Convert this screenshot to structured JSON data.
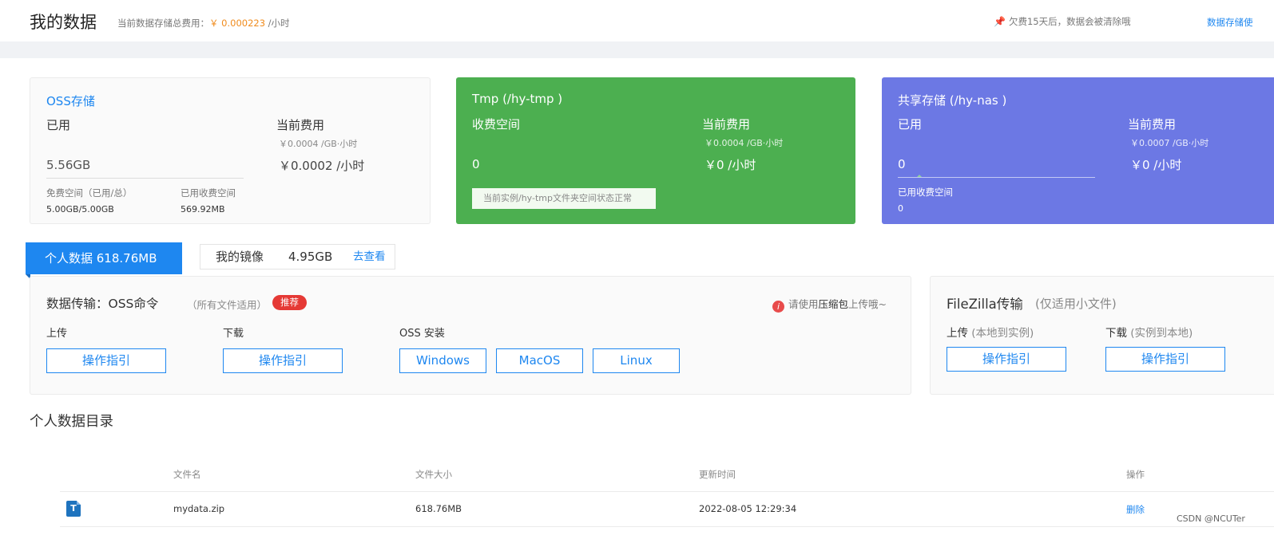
{
  "header": {
    "title": "我的数据",
    "total_fee_label": "当前数据存储总费用：",
    "total_fee_amount": "￥ 0.000223",
    "total_fee_unit": " /小时",
    "warning": "欠费15天后，数据会被清除哦",
    "link": "数据存储使"
  },
  "cards": {
    "oss": {
      "title": "OSS存储",
      "used_label": "已用",
      "used_value": "5.56GB",
      "fee_label": "当前费用",
      "fee_rate": "￥0.0004 /GB·小时",
      "fee_value": "￥0.0002 /小时",
      "free_label": "免费空间（已用/总）",
      "free_value": "5.00GB/5.00GB",
      "paid_label": "已用收费空间",
      "paid_value": "569.92MB"
    },
    "tmp": {
      "title": "Tmp (/hy-tmp )",
      "used_label": "收费空间",
      "used_value": "0",
      "fee_label": "当前费用",
      "fee_rate": "￥0.0004 /GB·小时",
      "fee_value": "￥0 /小时",
      "status": "当前实例/hy-tmp文件夹空间状态正常"
    },
    "nas": {
      "title": "共享存储 (/hy-nas )",
      "used_label": "已用",
      "used_value": "0",
      "fee_label": "当前费用",
      "fee_rate": "￥0.0007 /GB·小时",
      "fee_value": "￥0 /小时",
      "paid_label": "已用收费空间",
      "paid_value": "0"
    }
  },
  "tabs": {
    "personal": "个人数据 618.76MB",
    "mirror_label": "我的镜像",
    "mirror_size": "4.95GB",
    "mirror_link": "去查看"
  },
  "oss_panel": {
    "title": "数据传输：OSS命令",
    "note": "（所有文件适用）",
    "badge": "推荐",
    "tip_prefix": "请使用",
    "tip_strong": "压缩包",
    "tip_suffix": "上传哦~",
    "upload_label": "上传",
    "download_label": "下载",
    "install_label": "OSS 安装",
    "guide_button": "操作指引",
    "windows_button": "Windows",
    "macos_button": "MacOS",
    "linux_button": "Linux"
  },
  "fz_panel": {
    "title": "FileZilla传输",
    "note": "(仅适用小文件)",
    "upload_label": "上传",
    "upload_sub": " (本地到实例)",
    "download_label": "下载",
    "download_sub": " (实例到本地)",
    "guide_button": "操作指引"
  },
  "directory": {
    "title": "个人数据目录",
    "columns": [
      "文件名",
      "文件大小",
      "更新时间",
      "操作"
    ],
    "rows": [
      {
        "name": "mydata.zip",
        "size": "618.76MB",
        "time": "2022-08-05 12:29:34",
        "action": "删除",
        "icon": "T"
      }
    ]
  },
  "watermark": "CSDN @NCUTer"
}
